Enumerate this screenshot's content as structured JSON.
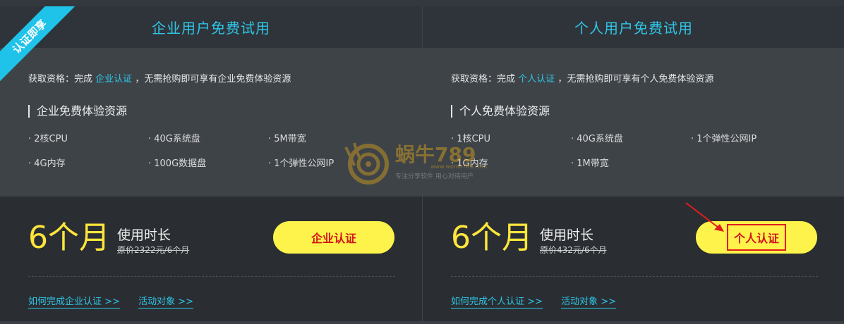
{
  "ribbon": "认证即享",
  "enterprise": {
    "title": "企业用户免费试用",
    "elig_prefix": "获取资格：完成",
    "elig_link": "企业认证",
    "elig_suffix": "，无需抢购即可享有企业免费体验资源",
    "res_title": "企业免费体验资源",
    "resources": [
      [
        "· 2核CPU",
        "· 40G系统盘",
        "· 5M带宽"
      ],
      [
        "· 4G内存",
        "· 100G数据盘",
        "· 1个弹性公网IP"
      ]
    ],
    "duration_big": "6个月",
    "duration_label": "使用时长",
    "orig_price": "原价2322元/6个月",
    "button": "企业认证",
    "link_how": "如何完成企业认证 >>",
    "link_target": "活动对象 >>"
  },
  "personal": {
    "title": "个人用户免费试用",
    "elig_prefix": "获取资格：完成",
    "elig_link": "个人认证",
    "elig_suffix": "，无需抢购即可享有个人免费体验资源",
    "res_title": "个人免费体验资源",
    "resources": [
      [
        "· 1核CPU",
        "· 40G系统盘",
        "· 1个弹性公网IP"
      ],
      [
        "· 1G内存",
        "· 1M带宽",
        ""
      ]
    ],
    "duration_big": "6个月",
    "duration_label": "使用时长",
    "orig_price": "原价432元/6个月",
    "button": "个人认证",
    "link_how": "如何完成个人认证 >>",
    "link_target": "活动对象 >>"
  },
  "watermark": {
    "brand": "蜗牛789",
    "sub": "专注分享软件 用心对待用户",
    "url": "www.woniu789.com"
  },
  "colors": {
    "accent": "#2fc6e6",
    "yellow": "#ffe53b",
    "button": "#fdf34a",
    "red": "#d4141b"
  }
}
